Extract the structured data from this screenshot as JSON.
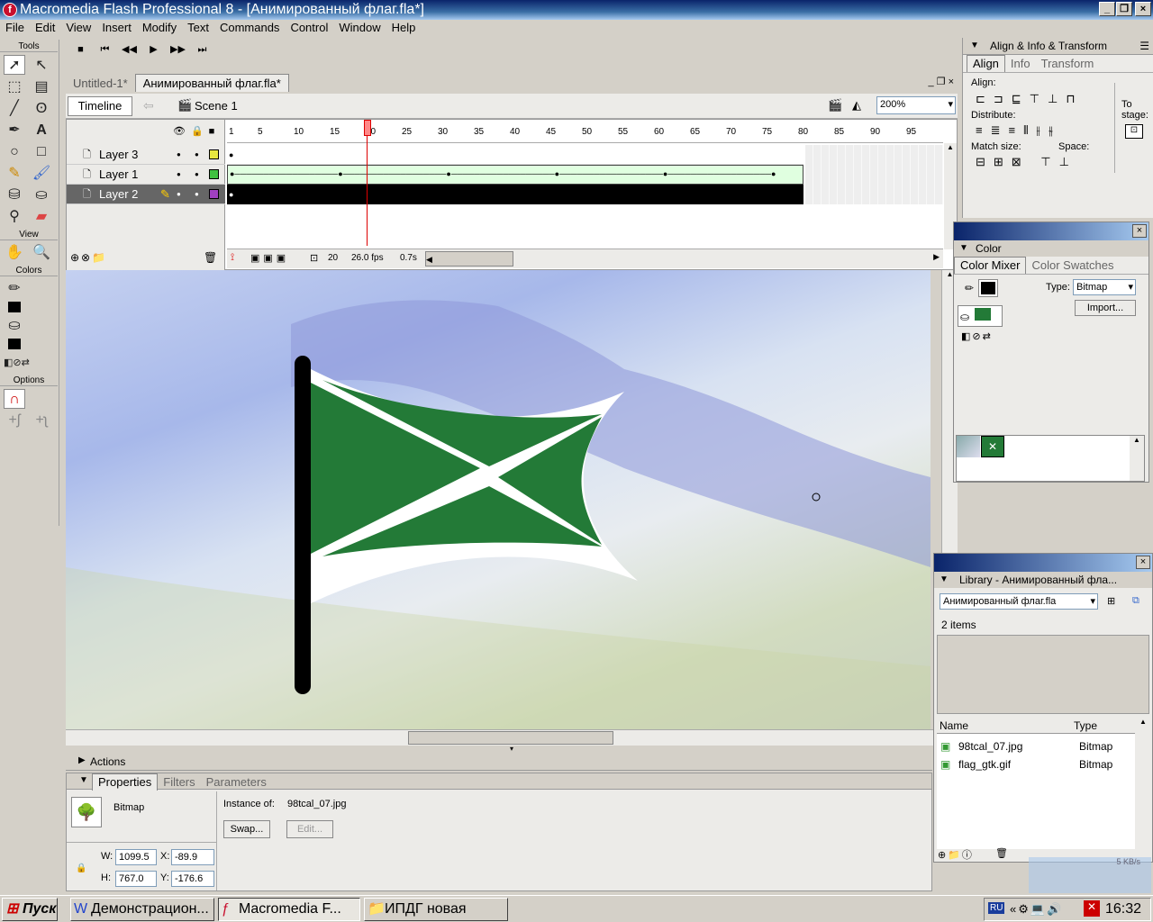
{
  "window": {
    "title": "Macromedia Flash Professional 8 - [Анимированный флаг.fla*]"
  },
  "menu": [
    "File",
    "Edit",
    "View",
    "Insert",
    "Modify",
    "Text",
    "Commands",
    "Control",
    "Window",
    "Help"
  ],
  "tools": {
    "header": "Tools",
    "view_header": "View",
    "colors_header": "Colors",
    "options_header": "Options"
  },
  "doc_tabs": [
    "Untitled-1*",
    "Анимированный флаг.fla*"
  ],
  "timeline": {
    "button": "Timeline",
    "scene": "Scene 1",
    "zoom": "200%",
    "ruler": [
      "1",
      "5",
      "10",
      "15",
      "20",
      "25",
      "30",
      "35",
      "40",
      "45",
      "50",
      "55",
      "60",
      "65",
      "70",
      "75",
      "80",
      "85",
      "90",
      "95"
    ],
    "layers": [
      {
        "name": "Layer 3",
        "color": "#e8e840"
      },
      {
        "name": "Layer 1",
        "color": "#40c040"
      },
      {
        "name": "Layer 2",
        "color": "#a040c0"
      }
    ],
    "current_frame": "20",
    "fps": "26.0 fps",
    "time": "0.7s"
  },
  "panels": {
    "align": {
      "title": "Align & Info & Transform",
      "tabs": [
        "Align",
        "Info",
        "Transform"
      ],
      "align_label": "Align:",
      "distribute_label": "Distribute:",
      "match_label": "Match size:",
      "space_label": "Space:",
      "to_stage": "To stage:"
    },
    "color": {
      "title": "Color",
      "tabs": [
        "Color Mixer",
        "Color Swatches"
      ],
      "type_label": "Type:",
      "type_value": "Bitmap",
      "import_button": "Import..."
    },
    "library": {
      "title": "Library - Анимированный фла...",
      "select": "Анимированный флаг.fla",
      "count": "2 items",
      "col_name": "Name",
      "col_type": "Type",
      "items": [
        {
          "name": "98tcal_07.jpg",
          "type": "Bitmap"
        },
        {
          "name": "flag_gtk.gif",
          "type": "Bitmap"
        }
      ]
    }
  },
  "actions": {
    "title": "Actions"
  },
  "properties": {
    "tabs": [
      "Properties",
      "Filters",
      "Parameters"
    ],
    "kind": "Bitmap",
    "instance_label": "Instance of:",
    "instance_value": "98tcal_07.jpg",
    "swap_button": "Swap...",
    "edit_button": "Edit...",
    "w_label": "W:",
    "w_value": "1099.5",
    "h_label": "H:",
    "h_value": "767.0",
    "x_label": "X:",
    "x_value": "-89.9",
    "y_label": "Y:",
    "y_value": "-176.6"
  },
  "tray": {
    "speed": "5 KB/s",
    "lang": "RU",
    "clock": "16:32"
  },
  "taskbar": {
    "start": "Пуск",
    "items": [
      "Демонстрацион...",
      "Macromedia F...",
      "ИПДГ новая"
    ]
  },
  "colors": {
    "flag_green": "#237a37",
    "title_blue": "#0a246a",
    "selected_layer": "#000000",
    "tween_fill": "#e0ffe0"
  }
}
